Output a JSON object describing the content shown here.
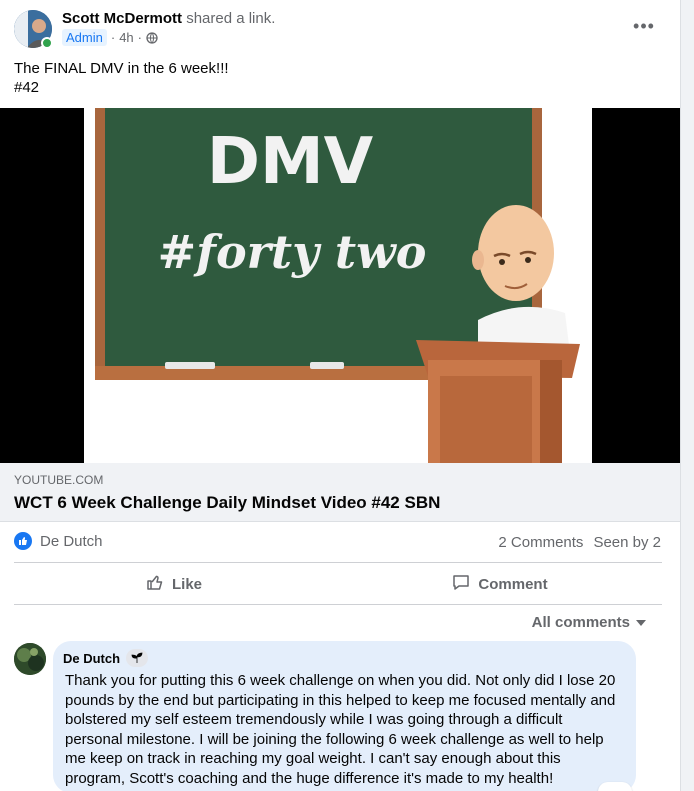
{
  "post": {
    "author": "Scott McDermott",
    "action": "shared a link.",
    "badge": "Admin",
    "time": "4h",
    "privacy_separator": "·",
    "more_label": "•••",
    "text_line1": "The FINAL DMV in the 6 week!!!",
    "text_line2": "#42"
  },
  "video": {
    "chalk_title": "DMV",
    "chalk_subtitle": "#forty two"
  },
  "link_preview": {
    "domain": "YOUTUBE.COM",
    "title": "WCT 6 Week Challenge Daily Mindset Video #42 SBN"
  },
  "reactions": {
    "reactor": "De Dutch",
    "comments_count": "2 Comments",
    "seen_by": "Seen by 2"
  },
  "actions": {
    "like_label": "Like",
    "comment_label": "Comment"
  },
  "comments_filter": {
    "label": "All comments"
  },
  "comment": {
    "author": "De Dutch",
    "text": "Thank you for putting this 6 week challenge on when you did. Not only did I lose 20 pounds by the end but participating in this helped to keep me focused mentally and bolstered my self esteem tremendously while I was going through a difficult personal milestone. I will be joining the following 6 week challenge as well to help me keep on track in reaching my goal weight. I can't say enough about this program, Scott's coaching and the huge difference it's made to my health!"
  },
  "colors": {
    "accent": "#1877f2",
    "online": "#31a24c",
    "chalkboard": "#2f5a3e",
    "frame": "#c97a4a"
  },
  "icons": {
    "privacy": "globe-icon",
    "like_badge": "thumbs-up-icon",
    "like_action": "thumbs-up-outline-icon",
    "comment_action": "speech-bubble-icon",
    "filter": "caret-down-icon",
    "badge": "sprout-icon"
  }
}
